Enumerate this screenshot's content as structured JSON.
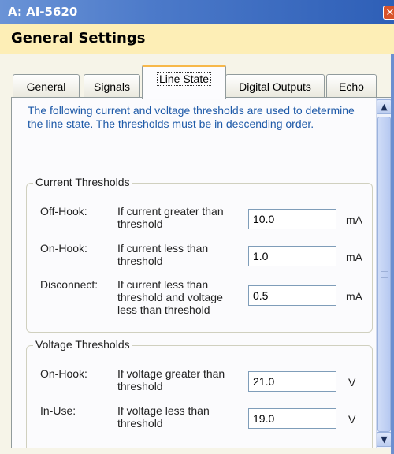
{
  "window": {
    "title": "A: AI-5620",
    "close_glyph": "✕"
  },
  "header": {
    "heading": "General Settings"
  },
  "tabs": [
    {
      "label": "General"
    },
    {
      "label": "Signals"
    },
    {
      "label": "Line State"
    },
    {
      "label": "Digital Outputs"
    },
    {
      "label": "Echo"
    }
  ],
  "active_tab": "Line State",
  "intro": "The following current and voltage thresholds are used to determine the line state.  The thresholds must be in descending order.",
  "current_group": {
    "title": "Current Thresholds",
    "rows": [
      {
        "name": "Off-Hook:",
        "desc": "If current greater than threshold",
        "value": "10.0",
        "unit": "mA"
      },
      {
        "name": "On-Hook:",
        "desc": "If current less than threshold",
        "value": "1.0",
        "unit": "mA"
      },
      {
        "name": "Disconnect:",
        "desc": "If current less than threshold and voltage less than threshold",
        "value": "0.5",
        "unit": "mA"
      }
    ]
  },
  "voltage_group": {
    "title": "Voltage Thresholds",
    "rows": [
      {
        "name": "On-Hook:",
        "desc": "If voltage greater than threshold",
        "value": "21.0",
        "unit": "V"
      },
      {
        "name": "In-Use:",
        "desc": "If voltage less than threshold",
        "value": "19.0",
        "unit": "V"
      }
    ]
  },
  "scrollbar": {
    "up_glyph": "▲",
    "down_glyph": "▼"
  }
}
